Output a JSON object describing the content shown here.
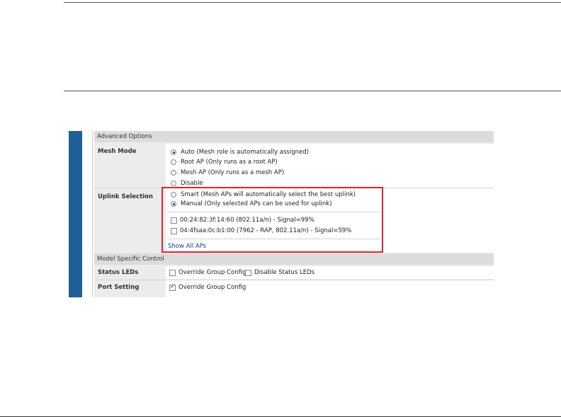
{
  "sections": {
    "advanced": "Advanced Options",
    "model": "Model Specific Control"
  },
  "mesh_mode": {
    "label": "Mesh Mode",
    "options": [
      {
        "text": "Auto (Mesh role is automatically assigned)",
        "checked": true
      },
      {
        "text": "Root AP (Only runs as a root AP)",
        "checked": false
      },
      {
        "text": "Mesh AP (Only runs as a mesh AP)",
        "checked": false
      },
      {
        "text": "Disable",
        "checked": false
      }
    ]
  },
  "uplink": {
    "label": "Uplink Selection",
    "options": [
      {
        "text": "Smart (Mesh APs will automatically select the best uplink)",
        "checked": false
      },
      {
        "text": "Manual (Only selected APs can be used for uplink)",
        "checked": true
      }
    ],
    "aps": [
      {
        "text": "00:24:82:3f:14:60 (802.11a/n) - Signal=99%",
        "checked": false
      },
      {
        "text": "04:4fsaa:0c:b1:00 (7962 - RAP, 802.11a/n) - Signal=59%",
        "checked": false
      }
    ],
    "show_all": "Show All APs"
  },
  "status_leds": {
    "label": "Status LEDs",
    "override": "Override Group Config",
    "disable": "Disable Status LEDs"
  },
  "port_setting": {
    "label": "Port Setting",
    "override": "Override Group Config"
  },
  "colors": {
    "accent_blue": "#1f5f97",
    "highlight_red": "#e0242b"
  }
}
